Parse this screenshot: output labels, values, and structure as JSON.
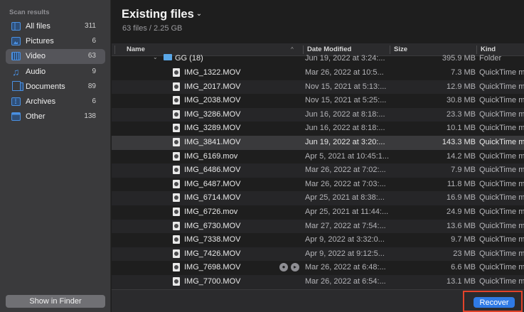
{
  "sidebar": {
    "heading": "Scan results",
    "items": [
      {
        "label": "All files",
        "count": "311",
        "icon": "all-files-icon"
      },
      {
        "label": "Pictures",
        "count": "6",
        "icon": "pictures-icon"
      },
      {
        "label": "Video",
        "count": "63",
        "icon": "video-icon",
        "selected": true
      },
      {
        "label": "Audio",
        "count": "9",
        "icon": "music-note-icon"
      },
      {
        "label": "Documents",
        "count": "89",
        "icon": "documents-icon"
      },
      {
        "label": "Archives",
        "count": "6",
        "icon": "archive-icon"
      },
      {
        "label": "Other",
        "count": "138",
        "icon": "other-icon"
      }
    ],
    "show_in_finder": "Show in Finder"
  },
  "header": {
    "title": "Existing files",
    "subtitle": "63 files / 2.25 GB"
  },
  "table": {
    "columns": [
      "Name",
      "Date Modified",
      "Size",
      "Kind"
    ],
    "folder_row": {
      "name": "GG (18)",
      "date": "Jun 19, 2022 at 3:24:...",
      "size": "395.9 MB",
      "kind": "Folder"
    },
    "rows": [
      {
        "name": "IMG_1322.MOV",
        "date": "Mar 26, 2022 at 10:5...",
        "size": "7.3 MB",
        "kind": "QuickTime m"
      },
      {
        "name": "IMG_2017.MOV",
        "date": "Nov 15, 2021 at 5:13:...",
        "size": "12.9 MB",
        "kind": "QuickTime m"
      },
      {
        "name": "IMG_2038.MOV",
        "date": "Nov 15, 2021 at 5:25:...",
        "size": "30.8 MB",
        "kind": "QuickTime m"
      },
      {
        "name": "IMG_3286.MOV",
        "date": "Jun 16, 2022 at 8:18:...",
        "size": "23.3 MB",
        "kind": "QuickTime m"
      },
      {
        "name": "IMG_3289.MOV",
        "date": "Jun 16, 2022 at 8:18:...",
        "size": "10.1 MB",
        "kind": "QuickTime m"
      },
      {
        "name": "IMG_3841.MOV",
        "date": "Jun 19, 2022 at 3:20:...",
        "size": "143.3 MB",
        "kind": "QuickTime m"
      },
      {
        "name": "IMG_6169.mov",
        "date": "Apr 5, 2021 at 10:45:1...",
        "size": "14.2 MB",
        "kind": "QuickTime m"
      },
      {
        "name": "IMG_6486.MOV",
        "date": "Mar 26, 2022 at 7:02:...",
        "size": "7.9 MB",
        "kind": "QuickTime m"
      },
      {
        "name": "IMG_6487.MOV",
        "date": "Mar 26, 2022 at 7:03:...",
        "size": "11.8 MB",
        "kind": "QuickTime m"
      },
      {
        "name": "IMG_6714.MOV",
        "date": "Apr 25, 2021 at 8:38:...",
        "size": "16.9 MB",
        "kind": "QuickTime m"
      },
      {
        "name": "IMG_6726.mov",
        "date": "Apr 25, 2021 at 11:44:...",
        "size": "24.9 MB",
        "kind": "QuickTime m"
      },
      {
        "name": "IMG_6730.MOV",
        "date": "Mar 27, 2022 at 7:54:...",
        "size": "13.6 MB",
        "kind": "QuickTime m"
      },
      {
        "name": "IMG_7338.MOV",
        "date": "Apr 9, 2022 at 3:32:0...",
        "size": "9.7 MB",
        "kind": "QuickTime m"
      },
      {
        "name": "IMG_7426.MOV",
        "date": "Apr 9, 2022 at 9:12:5...",
        "size": "23 MB",
        "kind": "QuickTime m"
      },
      {
        "name": "IMG_7698.MOV",
        "date": "Mar 26, 2022 at 6:48:...",
        "size": "6.6 MB",
        "kind": "QuickTime m"
      },
      {
        "name": "IMG_7700.MOV",
        "date": "Mar 26, 2022 at 6:54:...",
        "size": "13.1 MB",
        "kind": "QuickTime m"
      }
    ]
  },
  "footer": {
    "recover_label": "Recover"
  }
}
